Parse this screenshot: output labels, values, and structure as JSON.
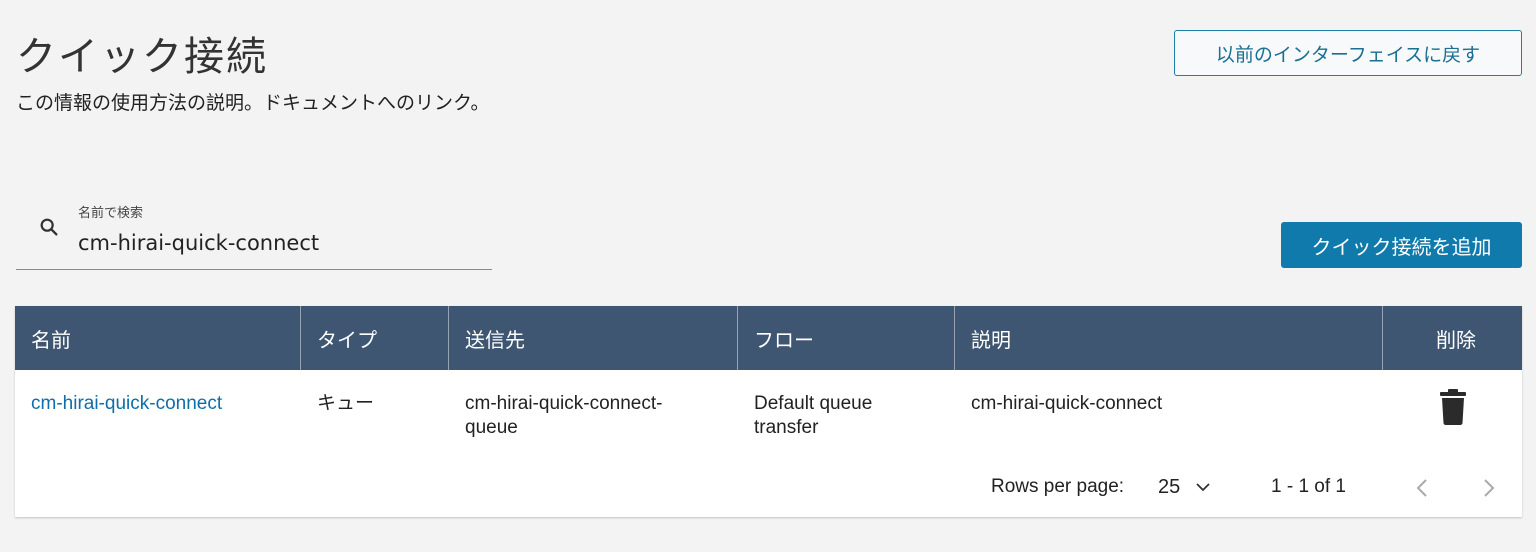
{
  "header": {
    "title": "クイック接続",
    "description": "この情報の使用方法の説明。ドキュメントへのリンク。",
    "back_button": "以前のインターフェイスに戻す"
  },
  "search": {
    "label": "名前で検索",
    "value": "cm-hirai-quick-connect"
  },
  "add_button": "クイック接続を追加",
  "table": {
    "columns": [
      "名前",
      "タイプ",
      "送信先",
      "フロー",
      "説明",
      "削除"
    ],
    "rows": [
      {
        "name": "cm-hirai-quick-connect",
        "type": "キュー",
        "destination_line1": "cm-hirai-quick-connect-",
        "destination_line2": "queue",
        "flow_line1": "Default queue",
        "flow_line2": "transfer",
        "description": "cm-hirai-quick-connect",
        "delete_icon": "trash-icon"
      }
    ]
  },
  "pagination": {
    "rows_per_page_label": "Rows per page:",
    "rows_per_page_value": "25",
    "range": "1 - 1 of 1"
  },
  "colors": {
    "header_bg": "#3e5672",
    "primary": "#0f7aab",
    "link": "#0f6ea8",
    "page_bg": "#f3f3f3"
  }
}
